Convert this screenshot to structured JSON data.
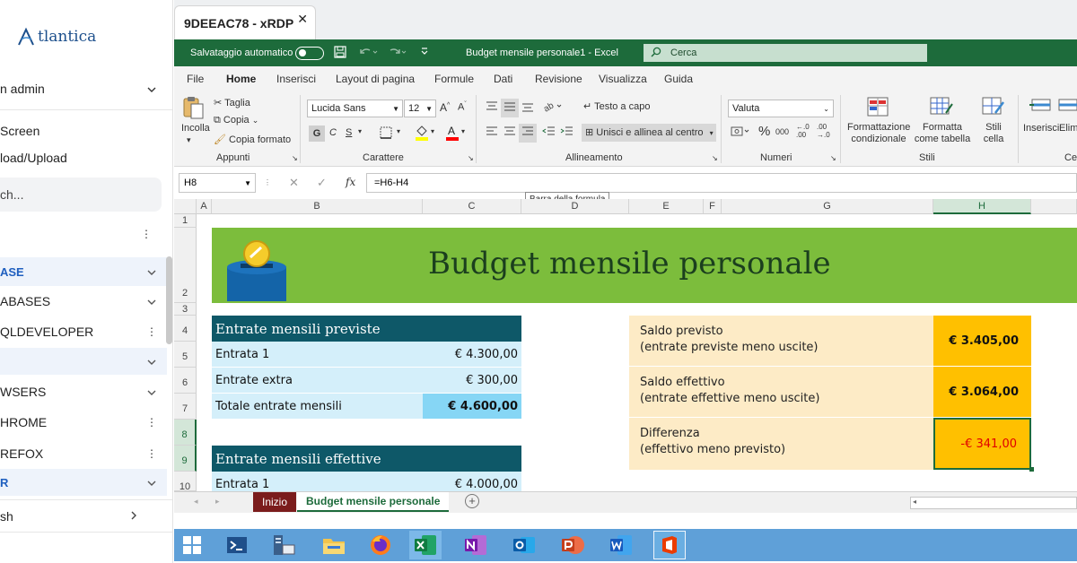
{
  "sidebar": {
    "brand": "tlantica",
    "user": "n admin",
    "menu": [
      "Screen",
      "load/Upload"
    ],
    "search_placeholder": "ch...",
    "groups": [
      {
        "label": "ASE",
        "style": "blue"
      },
      {
        "label": "ABASES",
        "style": "normal"
      },
      {
        "label": "QLDEVELOPER",
        "style": "normal"
      },
      {
        "label": "",
        "style": "blank"
      },
      {
        "label": "WSERS",
        "style": "normal"
      },
      {
        "label": "HROME",
        "style": "normal"
      },
      {
        "label": "REFOX",
        "style": "normal"
      },
      {
        "label": "R",
        "style": "blue"
      }
    ],
    "footer": "sh"
  },
  "browser_tab": {
    "title": "9DEEAC78 - xRDP",
    "close": "✕"
  },
  "excel": {
    "autosave_label": "Salvataggio automatico",
    "doc_title": "Budget mensile personale1  -  Excel",
    "search_label": "Cerca",
    "menu": [
      "File",
      "Home",
      "Inserisci",
      "Layout di pagina",
      "Formule",
      "Dati",
      "Revisione",
      "Visualizza",
      "Guida"
    ],
    "active_menu": "Home",
    "ribbon": {
      "paste": "Incolla",
      "cut": "Taglia",
      "copy": "Copia",
      "format_painter": "Copia formato",
      "font_name": "Lucida Sans",
      "font_size": "12",
      "bold": "G",
      "italic": "C",
      "underline": "S",
      "wrap": "Testo a capo",
      "merge": "Unisci e allinea al centro",
      "number_format": "Valuta",
      "cond_format": "Formattazione condizionale",
      "format_table": "Formatta come tabella",
      "cell_styles": "Stili cella",
      "insert": "Inserisci",
      "delete": "Elimi",
      "groups": {
        "clipboard": "Appunti",
        "font": "Carattere",
        "alignment": "Allineamento",
        "number": "Numeri",
        "styles": "Stili",
        "cells": "Ce"
      }
    },
    "formula_bar": {
      "cell_ref": "H8",
      "formula": "=H6-H4",
      "tooltip": "Barra della formula"
    },
    "columns": [
      "A",
      "B",
      "C",
      "D",
      "E",
      "F",
      "G",
      "H"
    ],
    "rows": [
      "1",
      "2",
      "3",
      "4",
      "5",
      "6",
      "7",
      "8",
      "9",
      "10"
    ],
    "selected_col": "H",
    "selected_rows": [
      "8",
      "9"
    ],
    "sheet": {
      "banner_title": "Budget mensile personale",
      "income_planned": {
        "header": "Entrate mensili previste",
        "rows": [
          {
            "label": "Entrata 1",
            "value": "€ 4.300,00"
          },
          {
            "label": "Entrate extra",
            "value": "€ 300,00"
          },
          {
            "label": "Totale entrate mensili",
            "value": "€ 4.600,00",
            "total": true
          }
        ]
      },
      "income_actual": {
        "header": "Entrate mensili effettive",
        "rows": [
          {
            "label": "Entrata 1",
            "value": "€ 4.000,00"
          }
        ]
      },
      "summary": [
        {
          "line1": "Saldo previsto",
          "line2": "(entrate previste meno uscite)",
          "value": "€ 3.405,00",
          "negative": false
        },
        {
          "line1": "Saldo effettivo",
          "line2": "(entrate effettive meno uscite)",
          "value": "€ 3.064,00",
          "negative": false
        },
        {
          "line1": "Differenza",
          "line2": "(effettivo meno previsto)",
          "value": "-€ 341,00",
          "negative": true
        }
      ]
    },
    "sheet_tabs": [
      "Inizio",
      "Budget mensile personale"
    ],
    "active_sheet": "Budget mensile personale"
  },
  "taskbar": {
    "items": [
      "windows-start",
      "powershell",
      "server-manager",
      "file-explorer",
      "firefox",
      "excel",
      "onenote",
      "outlook",
      "powerpoint",
      "word",
      "office"
    ],
    "active": "excel",
    "boxed": "office"
  },
  "colors": {
    "excel_green": "#1d6b3b",
    "banner_green": "#7cbd3c",
    "table_header": "#0e5868",
    "table_row": "#d4effa",
    "summary_bg": "#fdebc6",
    "summary_value": "#ffc000",
    "negative": "#e00000",
    "taskbar": "#5fa0d8"
  }
}
